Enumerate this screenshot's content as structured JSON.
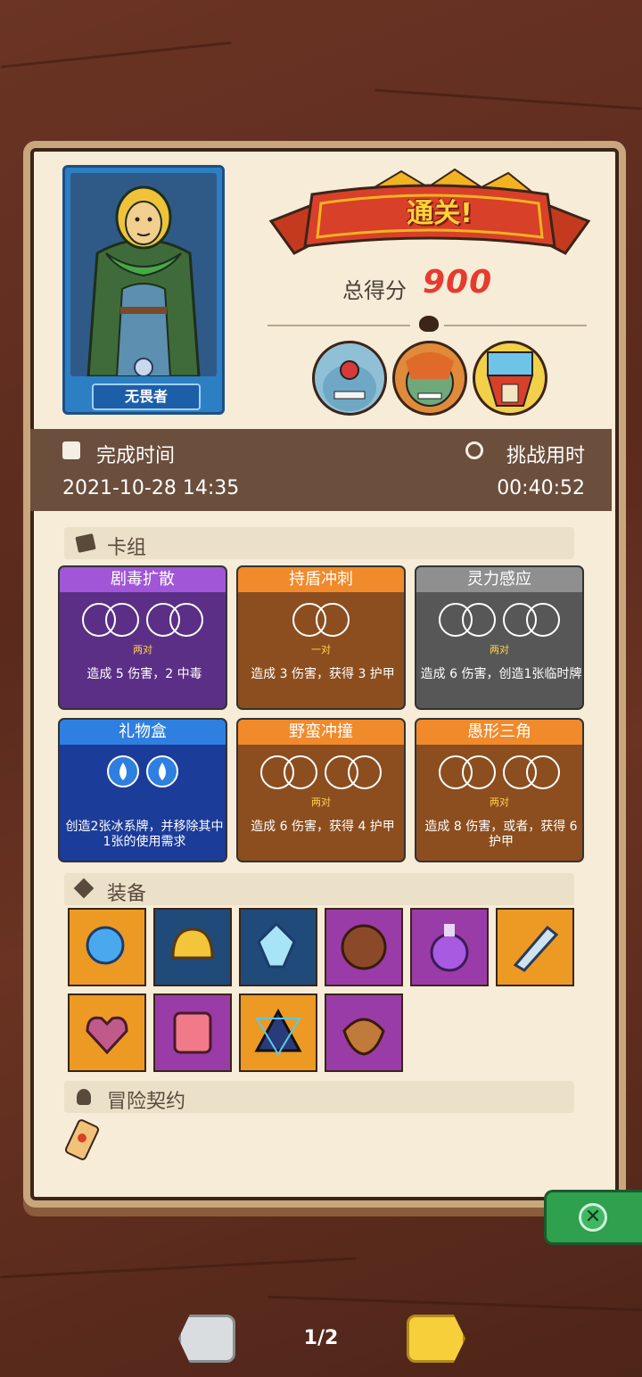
{
  "hero": {
    "name": "无畏者"
  },
  "result": {
    "banner": "通关!",
    "score_label": "总得分",
    "score_value": "900"
  },
  "times": {
    "finish_label": "完成时间",
    "finish_value": "2021-10-28 14:35",
    "challenge_label": "挑战用时",
    "challenge_value": "00:40:52"
  },
  "deck": {
    "heading": "卡组",
    "cards": [
      {
        "title": "剧毒扩散",
        "color": "purple",
        "sub": "两对",
        "desc": "造成 5 伤害，2 中毒"
      },
      {
        "title": "持盾冲刺",
        "color": "orange",
        "sub": "一对",
        "desc": "造成 3 伤害，获得 3 护甲"
      },
      {
        "title": "灵力感应",
        "color": "gray",
        "sub": "两对",
        "desc": "造成 6 伤害，创造1张临时牌"
      },
      {
        "title": "礼物盒",
        "color": "blue",
        "sub": "",
        "desc": "创造2张冰系牌，并移除其中1张的使用需求"
      },
      {
        "title": "野蛮冲撞",
        "color": "orange",
        "sub": "两对",
        "desc": "造成 6 伤害，获得 4 护甲"
      },
      {
        "title": "愚形三角",
        "color": "orange",
        "sub": "两对",
        "desc": "造成 8 伤害，或者，获得 6 护甲"
      }
    ]
  },
  "equipment": {
    "heading": "装备",
    "items": [
      {
        "icon": "blue-orb-icon",
        "bg": "orange"
      },
      {
        "icon": "golden-helmet-icon",
        "bg": "navy"
      },
      {
        "icon": "crystal-gem-icon",
        "bg": "navy"
      },
      {
        "icon": "wooden-button-icon",
        "bg": "purple"
      },
      {
        "icon": "purple-potion-icon",
        "bg": "purple"
      },
      {
        "icon": "broken-blade-icon",
        "bg": "orange"
      },
      {
        "icon": "thorny-heart-icon",
        "bg": "orange"
      },
      {
        "icon": "melting-block-icon",
        "bg": "purple"
      },
      {
        "icon": "hexagram-triangle-icon",
        "bg": "orange"
      },
      {
        "icon": "leather-shield-icon",
        "bg": "purple"
      }
    ]
  },
  "contract": {
    "heading": "冒险契约"
  },
  "pagination": {
    "page": "1/2"
  },
  "colors": {
    "score": "#e63b2e",
    "banner_text": "#ffd23a",
    "close_button": "#2ea04e"
  }
}
